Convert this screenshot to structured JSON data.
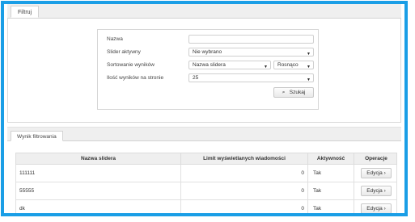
{
  "tabs": {
    "filter": "Filtruj",
    "results": "Wynik filtrowania"
  },
  "filter": {
    "name_label": "Nazwa",
    "name_value": "",
    "active_label": "Slider aktywny",
    "active_value": "Nie wybrano",
    "sort_label": "Sortowanie wyników",
    "sort_field_value": "Nazwa slidera",
    "sort_order_value": "Rosnąco",
    "count_label": "Ilość wyników na stronie",
    "count_value": "25",
    "search_label": "Szukaj",
    "caret": "▼",
    "search_icon": "⌕"
  },
  "table": {
    "headers": [
      "Nazwa slidera",
      "Limit wyświetlanych wiadomości",
      "Aktywność",
      "Operacje"
    ],
    "edit_label": "Edycja",
    "edit_arrow": "›",
    "rows": [
      {
        "name": "111111",
        "limit": "0",
        "active": "Tak"
      },
      {
        "name": "55555",
        "limit": "0",
        "active": "Tak"
      },
      {
        "name": "dk",
        "limit": "0",
        "active": "Tak"
      }
    ]
  }
}
